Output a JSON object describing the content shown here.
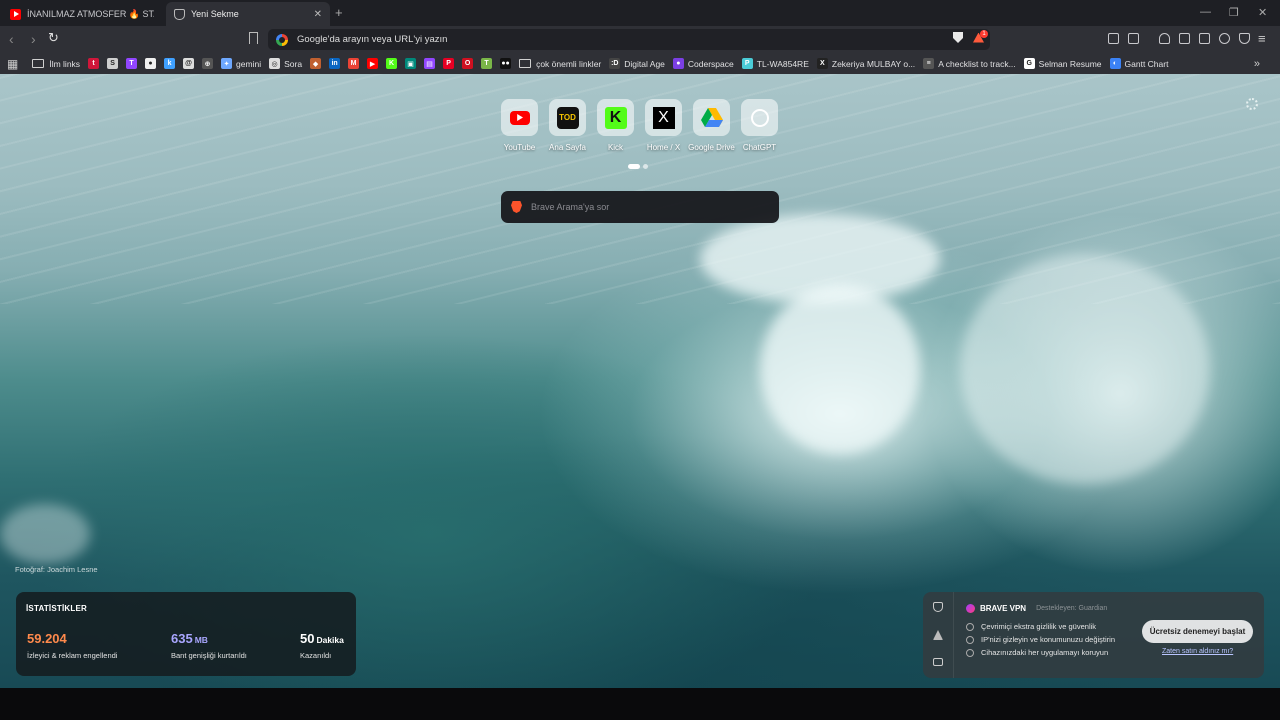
{
  "tabs": [
    {
      "title": "İNANILMAZ ATMOSFER 🔥 STADYUM",
      "favicon": "youtube-icon",
      "active": false
    },
    {
      "title": "Yeni Sekme",
      "favicon": "brave-shield-icon",
      "active": true
    }
  ],
  "toolbar": {
    "address_placeholder": "Google'da arayın veya URL'yi yazın",
    "rewards_badge": "1"
  },
  "bookmarks": [
    {
      "label": "İlm links",
      "icon": "folder-icon"
    },
    {
      "label": "",
      "icon": "tumblr-icon",
      "color": "#d0163a",
      "glyph": "t"
    },
    {
      "label": "",
      "icon": "skype-icon",
      "color": "#cfcfcf",
      "glyph": "S"
    },
    {
      "label": "",
      "icon": "twitch-icon",
      "color": "#9146ff",
      "glyph": "T"
    },
    {
      "label": "",
      "icon": "github-icon",
      "color": "#f0f0f0",
      "glyph": "●"
    },
    {
      "label": "",
      "icon": "k-icon",
      "color": "#3fa0ff",
      "glyph": "k"
    },
    {
      "label": "",
      "icon": "threads-icon",
      "color": "#ddd",
      "glyph": "@"
    },
    {
      "label": "",
      "icon": "ai-icon",
      "color": "#555",
      "glyph": "⊕"
    },
    {
      "label": "gemini",
      "icon": "gemini-icon",
      "color": "#6ea8ff",
      "glyph": "✦"
    },
    {
      "label": "Sora",
      "icon": "sora-icon",
      "color": "#ddd",
      "glyph": "◎"
    },
    {
      "label": "",
      "icon": "app-icon",
      "color": "#c06030",
      "glyph": "◆"
    },
    {
      "label": "",
      "icon": "linkedin-icon",
      "color": "#0a66c2",
      "glyph": "in"
    },
    {
      "label": "",
      "icon": "gmail-icon",
      "color": "#ea4335",
      "glyph": "M"
    },
    {
      "label": "",
      "icon": "youtube-icon",
      "color": "#ff0000",
      "glyph": "▶"
    },
    {
      "label": "",
      "icon": "kick-icon",
      "color": "#53fc18",
      "glyph": "K"
    },
    {
      "label": "",
      "icon": "meet-icon",
      "color": "#00897b",
      "glyph": "▣"
    },
    {
      "label": "",
      "icon": "twitch-icon-2",
      "color": "#9146ff",
      "glyph": "▤"
    },
    {
      "label": "",
      "icon": "pinterest-icon",
      "color": "#e60023",
      "glyph": "P"
    },
    {
      "label": "",
      "icon": "opera-icon",
      "color": "#d01020",
      "glyph": "O"
    },
    {
      "label": "",
      "icon": "tiny-icon",
      "color": "#7ab648",
      "glyph": "T"
    },
    {
      "label": "",
      "icon": "medium-icon",
      "color": "#111",
      "glyph": "●●"
    },
    {
      "label": "çok önemli linkler",
      "icon": "folder-icon"
    },
    {
      "label": "Digital Age",
      "icon": "digital-age-icon",
      "color": "#444",
      "glyph": ":D"
    },
    {
      "label": "Coderspace",
      "icon": "coderspace-icon",
      "color": "#7b3fe4",
      "glyph": "●"
    },
    {
      "label": "TL-WA854RE",
      "icon": "tplink-icon",
      "color": "#4acbd6",
      "glyph": "P"
    },
    {
      "label": "Zekeriya MULBAY o...",
      "icon": "x-icon",
      "color": "#222",
      "glyph": "X"
    },
    {
      "label": "A checklist to track...",
      "icon": "checklist-icon",
      "color": "#555",
      "glyph": "≡"
    },
    {
      "label": "Selman Resume",
      "icon": "google-icon",
      "color": "#fff",
      "glyph": "G"
    },
    {
      "label": "Gantt Chart",
      "icon": "gantt-icon",
      "color": "#3b82f6",
      "glyph": "◐"
    }
  ],
  "top_sites": [
    {
      "label": "YouTube",
      "icon": "youtube-icon"
    },
    {
      "label": "Ana Sayfa",
      "icon": "tod-icon"
    },
    {
      "label": "Kick",
      "icon": "kick-icon"
    },
    {
      "label": "Home / X",
      "icon": "x-icon"
    },
    {
      "label": "Google Drive",
      "icon": "google-drive-icon"
    },
    {
      "label": "ChatGPT",
      "icon": "chatgpt-icon"
    }
  ],
  "search": {
    "placeholder": "Brave Arama'ya sor"
  },
  "photo_credit": "Fotoğraf: Joachim Lesne",
  "stats": {
    "heading": "İSTATİSTİKLER",
    "items": [
      {
        "value": "59.204",
        "unit": "",
        "label": "İzleyici & reklam engellendi",
        "color": "#ff8a4c"
      },
      {
        "value": "635",
        "unit": "MB",
        "label": "Bant genişliği kurtarıldı",
        "color": "#a9a6ff"
      },
      {
        "value": "50",
        "unit": "Dakika",
        "label": "Kazanıldı",
        "color": "#ffffff"
      }
    ]
  },
  "vpn": {
    "title": "BRAVE VPN",
    "powered_by": "Destekleyen: Guardian",
    "features": [
      "Çevrimiçi ekstra gizlilik ve güvenlik",
      "IP'nizi gizleyin ve konumunuzu değiştirin",
      "Cihazınızdaki her uygulamayı koruyun"
    ],
    "cta_label": "Ücretsiz denemeyi başlat",
    "already_purchased": "Zaten satın aldınız mı?"
  }
}
